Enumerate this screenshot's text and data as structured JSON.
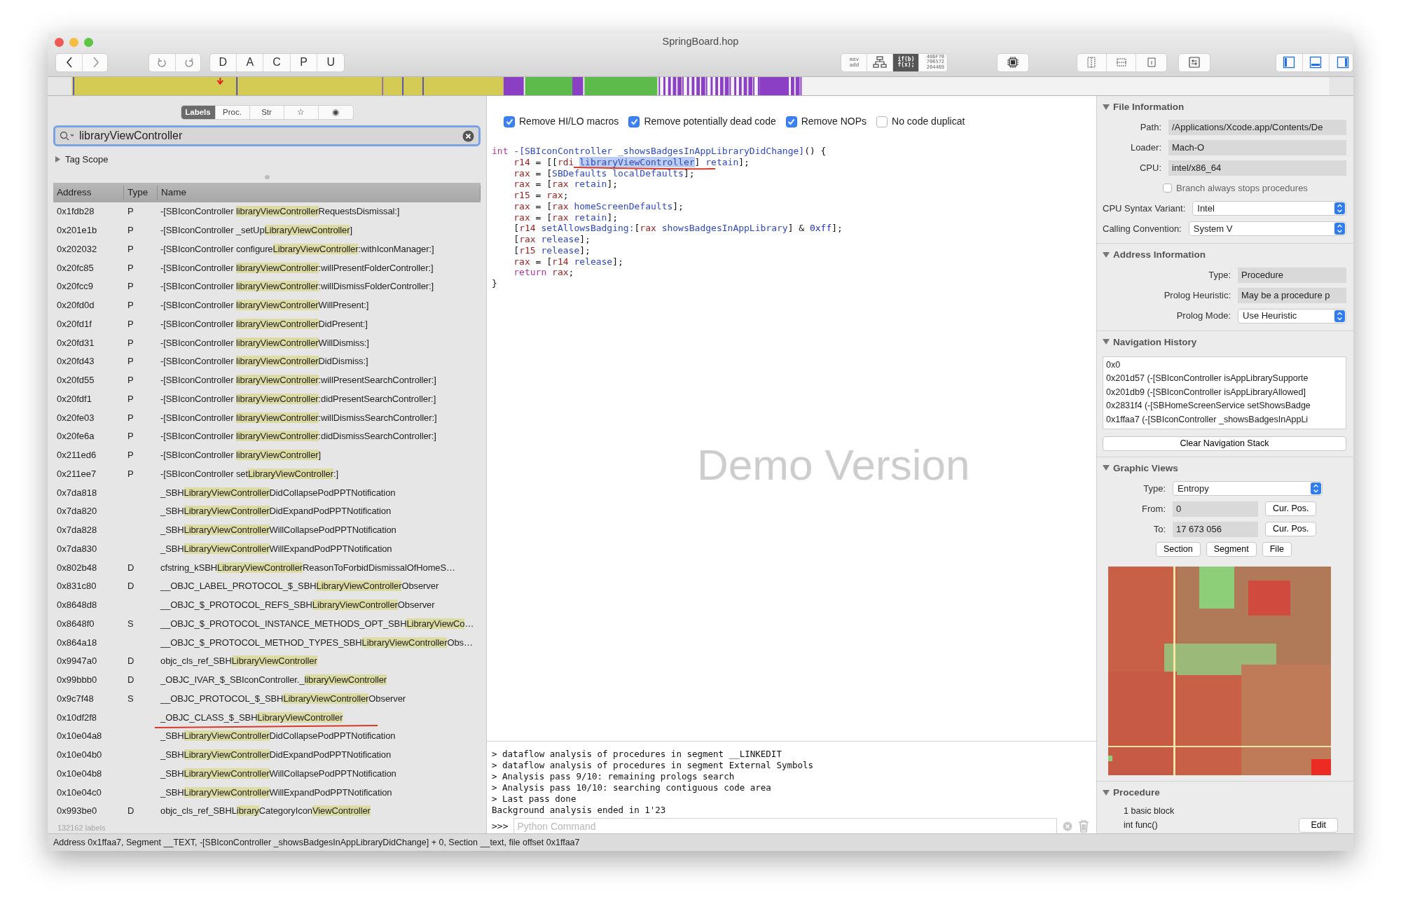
{
  "window": {
    "title": "SpringBoard.hop"
  },
  "toolbar": {
    "mode_buttons": [
      "D",
      "A",
      "C",
      "P",
      "U"
    ],
    "view_buttons": [
      {
        "kind": "text",
        "lines": [
          "mov",
          "add"
        ],
        "selected": false
      },
      {
        "kind": "graph",
        "selected": false
      },
      {
        "kind": "text",
        "lines": [
          "if(b)",
          "f(x);"
        ],
        "selected": true
      },
      {
        "kind": "hex",
        "lines": [
          "486F70",
          "706572",
          "204469"
        ],
        "selected": false
      }
    ],
    "panel_toggles": [
      {
        "kind": "left",
        "on": true
      },
      {
        "kind": "bottom",
        "on": true
      },
      {
        "kind": "right",
        "on": true
      }
    ]
  },
  "left_panel": {
    "tabs": [
      {
        "label": "Labels",
        "selected": true
      },
      {
        "label": "Proc.",
        "selected": false
      },
      {
        "label": "Str",
        "selected": false
      },
      {
        "label": "☆",
        "selected": false
      },
      {
        "label": "◉",
        "selected": false
      }
    ],
    "search": {
      "value": "libraryViewController"
    },
    "tag_scope": {
      "label": "Tag Scope",
      "expanded": false
    },
    "table": {
      "columns": [
        "Address",
        "Type",
        "Name"
      ],
      "rows": [
        {
          "address": "0x1fdb28",
          "type": "P",
          "name_parts": [
            "-[SBIconController ",
            "libraryViewController",
            "RequestsDismissal:]"
          ],
          "underlined": false
        },
        {
          "address": "0x201e1b",
          "type": "P",
          "name_parts": [
            "-[SBIconController _setUp",
            "LibraryViewController",
            "]"
          ],
          "underlined": false
        },
        {
          "address": "0x202032",
          "type": "P",
          "name_parts": [
            "-[SBIconController configure",
            "LibraryViewController",
            ":withIconManager:]"
          ],
          "underlined": false
        },
        {
          "address": "0x20fc85",
          "type": "P",
          "name_parts": [
            "-[SBIconController ",
            "libraryViewController",
            ":willPresentFolderController:]"
          ],
          "underlined": false
        },
        {
          "address": "0x20fcc9",
          "type": "P",
          "name_parts": [
            "-[SBIconController ",
            "libraryViewController",
            ":willDismissFolderController:]"
          ],
          "underlined": false
        },
        {
          "address": "0x20fd0d",
          "type": "P",
          "name_parts": [
            "-[SBIconController ",
            "libraryViewController",
            "WillPresent:]"
          ],
          "underlined": false
        },
        {
          "address": "0x20fd1f",
          "type": "P",
          "name_parts": [
            "-[SBIconController ",
            "libraryViewController",
            "DidPresent:]"
          ],
          "underlined": false
        },
        {
          "address": "0x20fd31",
          "type": "P",
          "name_parts": [
            "-[SBIconController ",
            "libraryViewController",
            "WillDismiss:]"
          ],
          "underlined": false
        },
        {
          "address": "0x20fd43",
          "type": "P",
          "name_parts": [
            "-[SBIconController ",
            "libraryViewController",
            "DidDismiss:]"
          ],
          "underlined": false
        },
        {
          "address": "0x20fd55",
          "type": "P",
          "name_parts": [
            "-[SBIconController ",
            "libraryViewController",
            ":willPresentSearchController:]"
          ],
          "underlined": false
        },
        {
          "address": "0x20fdf1",
          "type": "P",
          "name_parts": [
            "-[SBIconController ",
            "libraryViewController",
            ":didPresentSearchController:]"
          ],
          "underlined": false
        },
        {
          "address": "0x20fe03",
          "type": "P",
          "name_parts": [
            "-[SBIconController ",
            "libraryViewController",
            ":willDismissSearchController:]"
          ],
          "underlined": false
        },
        {
          "address": "0x20fe6a",
          "type": "P",
          "name_parts": [
            "-[SBIconController ",
            "libraryViewController",
            ":didDismissSearchController:]"
          ],
          "underlined": false
        },
        {
          "address": "0x211ed6",
          "type": "P",
          "name_parts": [
            "-[SBIconController ",
            "libraryViewController",
            "]"
          ],
          "underlined": false
        },
        {
          "address": "0x211ee7",
          "type": "P",
          "name_parts": [
            "-[SBIconController set",
            "LibraryViewController",
            ":]"
          ],
          "underlined": false
        },
        {
          "address": "0x7da818",
          "name_parts": [
            "_SBH",
            "LibraryViewController",
            "DidCollapsePodPPTNotification"
          ],
          "underlined": false
        },
        {
          "address": "0x7da820",
          "name_parts": [
            "_SBH",
            "LibraryViewController",
            "DidExpandPodPPTNotification"
          ],
          "underlined": false
        },
        {
          "address": "0x7da828",
          "name_parts": [
            "_SBH",
            "LibraryViewController",
            "WillCollapsePodPPTNotification"
          ],
          "underlined": false
        },
        {
          "address": "0x7da830",
          "name_parts": [
            "_SBH",
            "LibraryViewController",
            "WillExpandPodPPTNotification"
          ],
          "underlined": false
        },
        {
          "address": "0x802b48",
          "type": "D",
          "name_parts": [
            "cfstring_kSBH",
            "LibraryViewController",
            "ReasonToForbidDismissalOfHomeS…"
          ],
          "underlined": false
        },
        {
          "address": "0x831c80",
          "type": "D",
          "name_parts": [
            "__OBJC_LABEL_PROTOCOL_$_SBH",
            "LibraryViewController",
            "Observer"
          ],
          "underlined": false
        },
        {
          "address": "0x8648d8",
          "name_parts": [
            "__OBJC_$_PROTOCOL_REFS_SBH",
            "LibraryViewController",
            "Observer"
          ],
          "underlined": false
        },
        {
          "address": "0x8648f0",
          "type": "S",
          "name_parts": [
            "__OBJC_$_PROTOCOL_INSTANCE_METHODS_OPT_SBH",
            "LibraryViewCo",
            "…"
          ],
          "underlined": false
        },
        {
          "address": "0x864a18",
          "name_parts": [
            "__OBJC_$_PROTOCOL_METHOD_TYPES_SBH",
            "LibraryViewController",
            "Obs…"
          ],
          "underlined": false
        },
        {
          "address": "0x9947a0",
          "type": "D",
          "name_parts": [
            "objc_cls_ref_SBH",
            "LibraryViewController"
          ],
          "underlined": false
        },
        {
          "address": "0x99bbb0",
          "type": "D",
          "name_parts": [
            "_OBJC_IVAR_$_SBIconController._",
            "libraryViewController"
          ],
          "underlined": false
        },
        {
          "address": "0x9c7f48",
          "type": "S",
          "name_parts": [
            "__OBJC_PROTOCOL_$_SBH",
            "LibraryViewController",
            "Observer"
          ],
          "underlined": false
        },
        {
          "address": "0x10df2f8",
          "name_parts": [
            "_OBJC_CLASS_$_SBH",
            "LibraryViewController"
          ],
          "underlined": true
        },
        {
          "address": "0x10e04a8",
          "name_parts": [
            "_SBH",
            "LibraryViewController",
            "DidCollapsePodPPTNotification"
          ],
          "underlined": false
        },
        {
          "address": "0x10e04b0",
          "name_parts": [
            "_SBH",
            "LibraryViewController",
            "DidExpandPodPPTNotification"
          ],
          "underlined": false
        },
        {
          "address": "0x10e04b8",
          "name_parts": [
            "_SBH",
            "LibraryViewController",
            "WillCollapsePodPPTNotification"
          ],
          "underlined": false
        },
        {
          "address": "0x10e04c0",
          "name_parts": [
            "_SBH",
            "LibraryViewController",
            "WillExpandPodPPTNotification"
          ],
          "underlined": false
        },
        {
          "address": "0x993be0",
          "type": "D",
          "name_parts": [
            "objc_cls_ref_SBHL",
            "ibrary",
            "CategoryIcon",
            "ViewController"
          ],
          "underlined": false
        }
      ]
    },
    "footer": "132162 labels"
  },
  "code_view": {
    "options": [
      {
        "label": "Remove HI/LO macros",
        "checked": true
      },
      {
        "label": "Remove potentially dead code",
        "checked": true
      },
      {
        "label": "Remove NOPs",
        "checked": true
      },
      {
        "label": "No code duplicat",
        "checked": false
      }
    ],
    "watermark": "Demo Version",
    "lines": [
      {
        "indented": false,
        "underlined": false,
        "tokens": [
          {
            "text": "int ",
            "kind": "keyword"
          },
          {
            "text": "-[SBIconController _showsBadgesInAppLibraryDidChange]",
            "kind": "symbol"
          },
          {
            "text": "() {",
            "kind": "plain"
          }
        ]
      },
      {
        "indented": true,
        "underlined": true,
        "tokens": [
          {
            "text": "r14",
            "kind": "register"
          },
          {
            "text": " = [[",
            "kind": "plain"
          },
          {
            "text": "rdi ",
            "kind": "register"
          },
          {
            "text": "libraryViewController",
            "kind": "selected_symbol"
          },
          {
            "text": "] ",
            "kind": "plain"
          },
          {
            "text": "retain",
            "kind": "symbol"
          },
          {
            "text": "];",
            "kind": "plain"
          }
        ]
      },
      {
        "indented": true,
        "underlined": false,
        "tokens": [
          {
            "text": "rax",
            "kind": "register"
          },
          {
            "text": " = [",
            "kind": "plain"
          },
          {
            "text": "SBDefaults localDefaults",
            "kind": "symbol"
          },
          {
            "text": "];",
            "kind": "plain"
          }
        ]
      },
      {
        "indented": true,
        "underlined": false,
        "tokens": [
          {
            "text": "rax",
            "kind": "register"
          },
          {
            "text": " = [",
            "kind": "plain"
          },
          {
            "text": "rax ",
            "kind": "register"
          },
          {
            "text": "retain",
            "kind": "symbol"
          },
          {
            "text": "];",
            "kind": "plain"
          }
        ]
      },
      {
        "indented": true,
        "underlined": false,
        "tokens": [
          {
            "text": "r15",
            "kind": "register"
          },
          {
            "text": " = ",
            "kind": "plain"
          },
          {
            "text": "rax",
            "kind": "register"
          },
          {
            "text": ";",
            "kind": "plain"
          }
        ]
      },
      {
        "indented": true,
        "underlined": false,
        "tokens": [
          {
            "text": "rax",
            "kind": "register"
          },
          {
            "text": " = [",
            "kind": "plain"
          },
          {
            "text": "rax ",
            "kind": "register"
          },
          {
            "text": "homeScreenDefaults",
            "kind": "symbol"
          },
          {
            "text": "];",
            "kind": "plain"
          }
        ]
      },
      {
        "indented": true,
        "underlined": false,
        "tokens": [
          {
            "text": "rax",
            "kind": "register"
          },
          {
            "text": " = [",
            "kind": "plain"
          },
          {
            "text": "rax ",
            "kind": "register"
          },
          {
            "text": "retain",
            "kind": "symbol"
          },
          {
            "text": "];",
            "kind": "plain"
          }
        ]
      },
      {
        "indented": true,
        "underlined": false,
        "tokens": [
          {
            "text": "[",
            "kind": "plain"
          },
          {
            "text": "r14 ",
            "kind": "register"
          },
          {
            "text": "setAllowsBadging:",
            "kind": "symbol"
          },
          {
            "text": "[",
            "kind": "plain"
          },
          {
            "text": "rax ",
            "kind": "register"
          },
          {
            "text": "showsBadgesInAppLibrary",
            "kind": "symbol"
          },
          {
            "text": "] & ",
            "kind": "plain"
          },
          {
            "text": "0xff",
            "kind": "number"
          },
          {
            "text": "];",
            "kind": "plain"
          }
        ]
      },
      {
        "indented": true,
        "underlined": false,
        "tokens": [
          {
            "text": "[",
            "kind": "plain"
          },
          {
            "text": "rax ",
            "kind": "register"
          },
          {
            "text": "release",
            "kind": "symbol"
          },
          {
            "text": "];",
            "kind": "plain"
          }
        ]
      },
      {
        "indented": true,
        "underlined": false,
        "tokens": [
          {
            "text": "[",
            "kind": "plain"
          },
          {
            "text": "r15 ",
            "kind": "register"
          },
          {
            "text": "release",
            "kind": "symbol"
          },
          {
            "text": "];",
            "kind": "plain"
          }
        ]
      },
      {
        "indented": true,
        "underlined": false,
        "tokens": [
          {
            "text": "rax",
            "kind": "register"
          },
          {
            "text": " = [",
            "kind": "plain"
          },
          {
            "text": "r14 ",
            "kind": "register"
          },
          {
            "text": "release",
            "kind": "symbol"
          },
          {
            "text": "];",
            "kind": "plain"
          }
        ]
      },
      {
        "indented": true,
        "underlined": false,
        "tokens": [
          {
            "text": "return ",
            "kind": "keyword"
          },
          {
            "text": "rax",
            "kind": "register"
          },
          {
            "text": ";",
            "kind": "plain"
          }
        ]
      },
      {
        "indented": false,
        "underlined": false,
        "tokens": [
          {
            "text": "}",
            "kind": "plain"
          }
        ]
      }
    ]
  },
  "console": {
    "lines": [
      "> dataflow analysis of procedures in segment __LINKEDIT",
      "> dataflow analysis of procedures in segment External Symbols",
      "> Analysis pass 9/10: remaining prologs search",
      "> Analysis pass 10/10: searching contiguous code area",
      "> Last pass done",
      "Background analysis ended in 1'23"
    ],
    "prompt": ">>>",
    "input": {
      "placeholder": "Python Command"
    }
  },
  "inspector": {
    "sections": [
      {
        "title": "File Information",
        "expanded": true,
        "rows": [
          {
            "kind": "field",
            "label": "Path:",
            "value": "/Applications/Xcode.app/Contents/De"
          },
          {
            "kind": "field",
            "label": "Loader:",
            "value": "Mach-O"
          },
          {
            "kind": "field",
            "label": "CPU:",
            "value": "intel/x86_64"
          },
          {
            "kind": "checkbox",
            "label": "Branch always stops procedures",
            "checked": false
          },
          {
            "kind": "select",
            "label": "CPU Syntax Variant:",
            "value": "Intel"
          },
          {
            "kind": "select",
            "label": "Calling Convention:",
            "value": "System V"
          }
        ]
      },
      {
        "title": "Address Information",
        "expanded": true,
        "rows": [
          {
            "kind": "field",
            "label": "Type:",
            "value": "Procedure"
          },
          {
            "kind": "field",
            "label": "Prolog Heuristic:",
            "value": "May be a procedure p"
          },
          {
            "kind": "select",
            "label": "Prolog Mode:",
            "value": "Use Heuristic"
          }
        ]
      },
      {
        "title": "Navigation History",
        "expanded": true,
        "rows": [
          {
            "kind": "list",
            "items": [
              "0x0",
              "0x201d57 (-[SBIconController isAppLibrarySupporte",
              "0x201db9 (-[SBIconController isAppLibraryAllowed]",
              "0x2831f4 (-[SBHomeScreenService setShowsBadge",
              "0x1ffaa7 (-[SBIconController _showsBadgesInAppLi"
            ]
          },
          {
            "kind": "wide_button",
            "label": "Clear Navigation Stack"
          }
        ]
      },
      {
        "title": "Graphic Views",
        "expanded": true,
        "rows": [
          {
            "kind": "select",
            "label": "Type:",
            "value": "Entropy"
          },
          {
            "kind": "field",
            "label": "From:",
            "value": "0",
            "button": "Cur. Pos."
          },
          {
            "kind": "field",
            "label": "To:",
            "value": "17 673 056",
            "button": "Cur. Pos."
          },
          {
            "kind": "buttons",
            "labels": [
              "Section",
              "Segment",
              "File"
            ]
          },
          {
            "kind": "entropy_map"
          }
        ]
      },
      {
        "title": "Procedure",
        "expanded": true,
        "rows": [
          {
            "kind": "text",
            "value": "1 basic block"
          },
          {
            "kind": "text",
            "value": "int func()",
            "button": "Edit"
          }
        ]
      }
    ]
  },
  "status_bar": "Address 0x1ffaa7, Segment __TEXT, -[SBIconController _showsBadgesInAppLibraryDidChange] + 0, Section __text, file offset 0x1ffaa7"
}
